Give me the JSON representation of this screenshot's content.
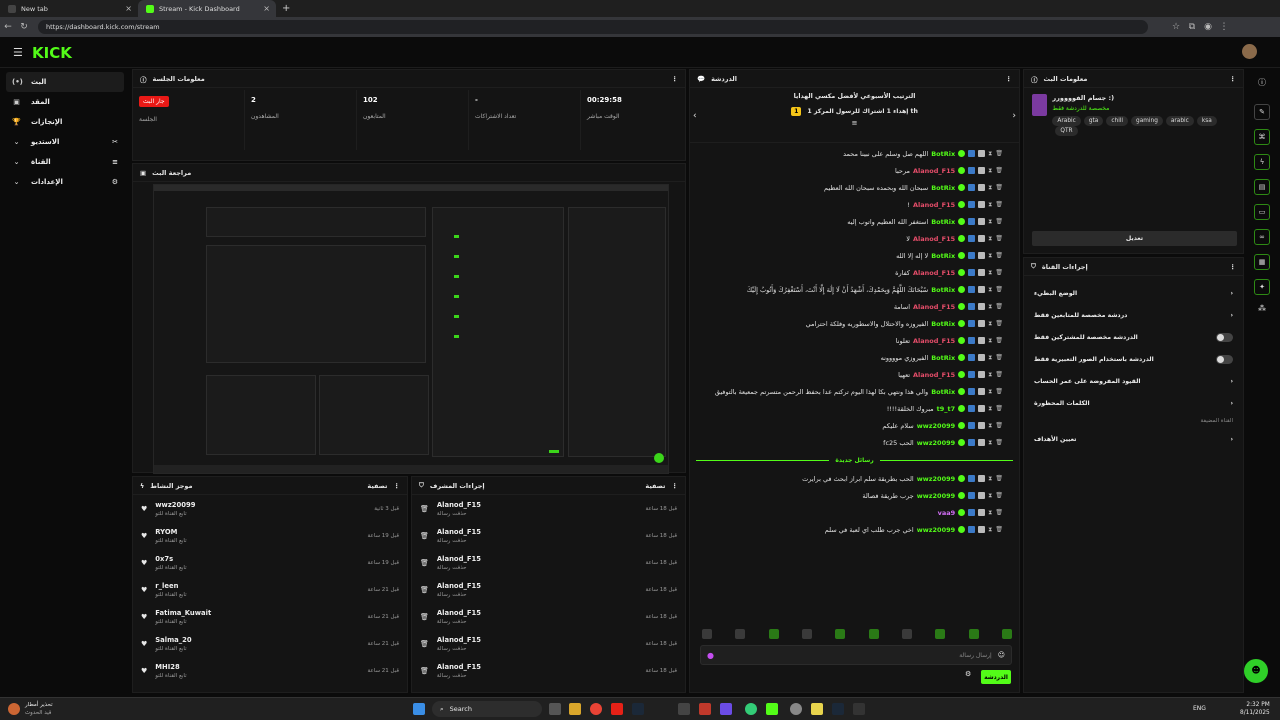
{
  "browser": {
    "tabs": [
      {
        "label": "New tab"
      },
      {
        "label": "Stream - Kick Dashboard"
      }
    ],
    "new_tab": "+",
    "url": "https://dashboard.kick.com/stream"
  },
  "app": {
    "logo": "KICK"
  },
  "sidebar": {
    "items": [
      {
        "label": "البث",
        "icon": "(•)"
      },
      {
        "label": "المقد",
        "icon": "▣"
      },
      {
        "label": "الإنجازات",
        "icon": "🏆"
      },
      {
        "label": "الاستديو",
        "icon": "✂"
      },
      {
        "label": "القناة",
        "icon": "≡"
      },
      {
        "label": "الإعدادات",
        "icon": "⚙"
      }
    ]
  },
  "session": {
    "title": "معلومات الجلسة",
    "stats": [
      {
        "value": "جار البث",
        "label": "الجلسة",
        "live": true
      },
      {
        "value": "2",
        "label": "المشاهدون"
      },
      {
        "value": "102",
        "label": "المتابعون"
      },
      {
        "value": "-",
        "label": "تعداد الاشتراكات"
      },
      {
        "value": "00:29:58",
        "label": "الوقت مباشر"
      }
    ]
  },
  "preview": {
    "title": "مراجعة البث"
  },
  "activity": {
    "title": "موجز النشاط",
    "filter": "تصفية",
    "items": [
      {
        "name": "wwz20099",
        "sub": "تابع القناة للتو",
        "time": "قبل 3 ثانية"
      },
      {
        "name": "RYOM",
        "sub": "تابع القناة للتو",
        "time": "قبل 19 ساعة"
      },
      {
        "name": "0x7s",
        "sub": "تابع القناة للتو",
        "time": "قبل 19 ساعة"
      },
      {
        "name": "r_leen",
        "sub": "تابع القناة للتو",
        "time": "قبل 21 ساعة"
      },
      {
        "name": "Fatima_Kuwait",
        "sub": "تابع القناة للتو",
        "time": "قبل 21 ساعة"
      },
      {
        "name": "Salma_20",
        "sub": "تابع القناة للتو",
        "time": "قبل 21 ساعة"
      },
      {
        "name": "MHI28",
        "sub": "تابع القناة للتو",
        "time": "قبل 21 ساعة"
      }
    ]
  },
  "modactions": {
    "title": "إجراءات المشرف",
    "filter": "تصفية",
    "items": [
      {
        "name": "Alanod_F15",
        "sub": "حذفت رسالة",
        "time": "قبل 18 ساعة"
      },
      {
        "name": "Alanod_F15",
        "sub": "حذفت رسالة",
        "time": "قبل 18 ساعة"
      },
      {
        "name": "Alanod_F15",
        "sub": "حذفت رسالة",
        "time": "قبل 18 ساعة"
      },
      {
        "name": "Alanod_F15",
        "sub": "حذفت رسالة",
        "time": "قبل 18 ساعة"
      },
      {
        "name": "Alanod_F15",
        "sub": "حذفت رسالة",
        "time": "قبل 18 ساعة"
      },
      {
        "name": "Alanod_F15",
        "sub": "حذفت رسالة",
        "time": "قبل 18 ساعة"
      },
      {
        "name": "Alanod_F15",
        "sub": "حذفت رسالة",
        "time": "قبل 18 ساعة"
      }
    ]
  },
  "chat": {
    "title": "الدردشة",
    "pinned_title": "الترتيب الأسبوعي لأفضل مكسي الهدايا",
    "pinned_rank": "1",
    "pinned_line": "إهداء 1 اشتراك للرسول المركز 1 th",
    "new_messages": "رسائل جديدة",
    "messages": [
      {
        "user": "BotRix",
        "color": "green",
        "text": "اللهم صل وسلم على نبينا محمد"
      },
      {
        "user": "Alanod_F15",
        "color": "red",
        "text": "مرحبا"
      },
      {
        "user": "BotRix",
        "color": "green",
        "text": "سبحان الله وبحمده سبحان الله العظيم"
      },
      {
        "user": "Alanod_F15",
        "color": "red",
        "text": "!"
      },
      {
        "user": "BotRix",
        "color": "green",
        "text": "استغفر الله العظيم واتوب إليه"
      },
      {
        "user": "Alanod_F15",
        "color": "red",
        "text": "لا"
      },
      {
        "user": "BotRix",
        "color": "green",
        "text": "لا إله إلا الله"
      },
      {
        "user": "Alanod_F15",
        "color": "red",
        "text": "كفارة"
      },
      {
        "user": "BotRix",
        "color": "green",
        "text": "سُبْحَانَكَ اللَّهُمَّ وَبِحَمْدِكَ، أَشْهَدُ أَنْ لَا إِلَٰهَ إِلَّا أَنْتَ، أَسْتَغْفِرُكَ وَأَتُوبُ إِلَيْكَ"
      },
      {
        "user": "Alanod_F15",
        "color": "red",
        "text": "اسامة"
      },
      {
        "user": "BotRix",
        "color": "green",
        "text": "الفيروزه والاحتلال والاسطوريه وفلكة احترامي"
      },
      {
        "user": "Alanod_F15",
        "color": "red",
        "text": "تعلونا"
      },
      {
        "user": "BotRix",
        "color": "green",
        "text": "الفيروزي موووونه"
      },
      {
        "user": "Alanod_F15",
        "color": "red",
        "text": "تعهيا"
      },
      {
        "user": "BotRix",
        "color": "green",
        "text": "والي هذا ونتهي بكا لهذا اليوم تركتم عدا بحفظ الرحمن متسرتم جمعيعة بالتوفيق"
      },
      {
        "user": "t9_t7",
        "color": "green",
        "text": "!!!!مبروك الخلقة"
      },
      {
        "user": "wwz20099",
        "color": "green",
        "text": "سلام عليكم"
      },
      {
        "user": "wwz20099",
        "color": "green",
        "text": "fc25 الحب"
      }
    ],
    "new": [
      {
        "user": "wwz20099",
        "color": "green",
        "text": "الحب بطريقة سلم ابراز ابحث في برايرت"
      },
      {
        "user": "wwz20099",
        "color": "green",
        "text": "جرب طريقة فصالة"
      },
      {
        "user": "vaa9",
        "color": "pink",
        "text": ""
      },
      {
        "user": "wwz20099",
        "color": "green",
        "text": "اخي جرب طلب اي لعبة في سلم"
      }
    ],
    "input_placeholder": "إرسال رسالة",
    "send_label": "الدردشة"
  },
  "stream_info": {
    "title": "معلومات البث",
    "stream_title": "جسام الفوووورر :)",
    "category": "مخصصة للدردشة فقط",
    "tags": [
      "Arabic",
      "gta",
      "chill",
      "gaming",
      "arabic",
      "ksa",
      "QTR"
    ],
    "edit_label": "تعديل"
  },
  "channel_actions": {
    "title": "إجراءات القناة",
    "rows": [
      {
        "label": "الوضع البطيء",
        "type": "chevron"
      },
      {
        "label": "دردشة مخصصة للمتابعين فقط",
        "type": "chevron"
      },
      {
        "label": "الدردشة مخصصة للمشتركين فقط",
        "type": "toggle"
      },
      {
        "label": "الدردشة باستخدام الصور التعبيرية فقط",
        "type": "toggle"
      },
      {
        "label": "القيود المفروضة على عمر الحساب",
        "type": "chevron"
      },
      {
        "label": "الكلمات المحظورة",
        "type": "chevron"
      }
    ],
    "section_label": "القناة المضيفة",
    "host_row": "تعيين الأهداف"
  },
  "taskbar": {
    "weather_line1": "تحذير أمطار",
    "weather_line2": "قيد الحدوث",
    "search": "Search",
    "lang": "ENG",
    "time": "2:32 PM",
    "date": "8/11/2025"
  }
}
